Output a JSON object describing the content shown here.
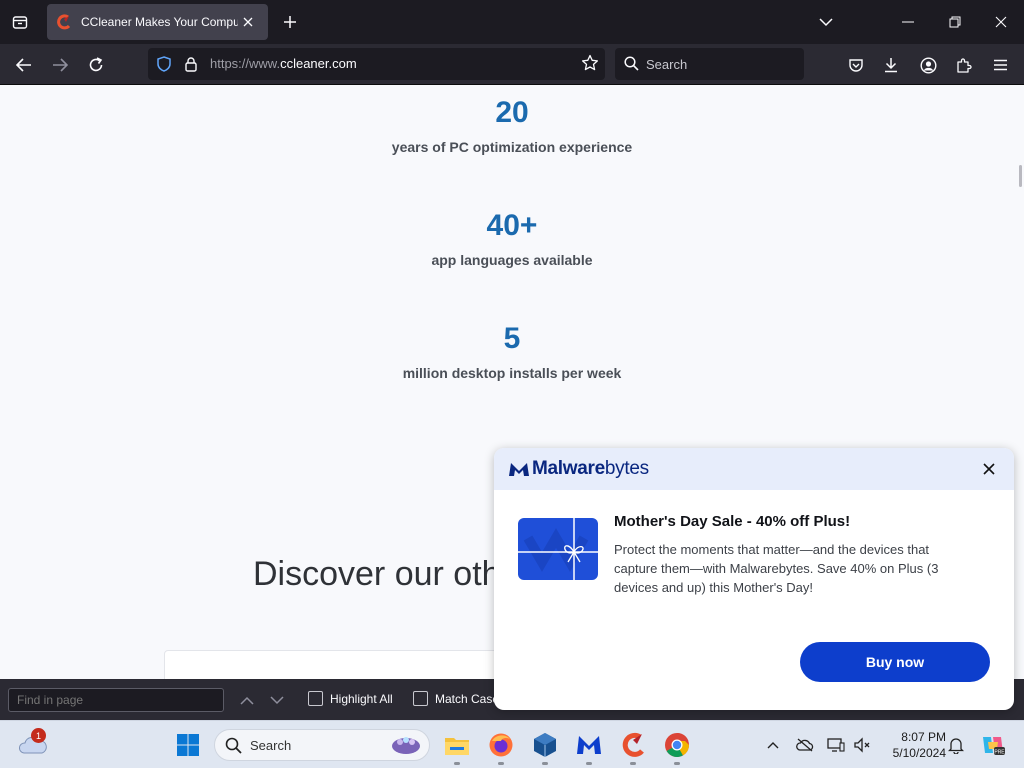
{
  "browser": {
    "tab": {
      "title": "CCleaner Makes Your Computer Faster"
    },
    "url": {
      "prefix": "https://www.",
      "domain": "ccleaner.com"
    },
    "search_placeholder": "Search"
  },
  "page": {
    "stats": [
      {
        "number": "20",
        "label": "years of PC optimization experience"
      },
      {
        "number": "40+",
        "label": "app languages available"
      },
      {
        "number": "5",
        "label": "million desktop installs per week"
      }
    ],
    "discover_heading": "Discover our oth"
  },
  "findbar": {
    "placeholder": "Find in page",
    "highlight_all": "Highlight All",
    "match_case": "Match Case"
  },
  "popup": {
    "brand_bold": "Malware",
    "brand_light": "bytes",
    "title": "Mother's Day Sale - 40% off Plus!",
    "body": "Protect the moments that matter—and the devices that capture them—with Malwarebytes. Save 40% on Plus (3 devices and up) this Mother's Day!",
    "cta": "Buy now"
  },
  "taskbar": {
    "weather_badge": "1",
    "search_placeholder": "Search",
    "time": "8:07 PM",
    "date": "5/10/2024",
    "icons": [
      "start-icon",
      "file-explorer-icon",
      "firefox-icon",
      "virtualbox-icon",
      "malwarebytes-icon",
      "ccleaner-icon",
      "chrome-icon"
    ]
  },
  "colors": {
    "accent_stat": "#1b6aae",
    "popup_button": "#0d3ecc",
    "popup_header": "#e7edfb"
  }
}
